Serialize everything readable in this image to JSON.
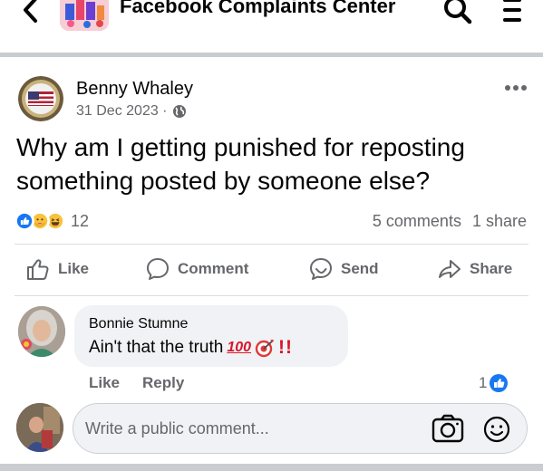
{
  "header": {
    "title": "Facebook Complaints Center",
    "back_icon": "chevron-left-icon",
    "search_icon": "search-icon",
    "menu_icon": "menu-icon"
  },
  "post": {
    "author": "Benny Whaley",
    "date": "31 Dec 2023 ·",
    "privacy_icon": "globe-icon",
    "text": "Why am I getting punished for reposting something posted by someone else?",
    "reaction_icons": [
      "like-reaction-icon",
      "care-reaction-icon",
      "haha-reaction-icon"
    ],
    "reaction_count": "12",
    "comments_count": "5 comments",
    "shares_count": "1 share"
  },
  "actions": {
    "like": "Like",
    "comment": "Comment",
    "send": "Send",
    "share": "Share"
  },
  "comment": {
    "author": "Bonnie Stumne",
    "text": "Ain't that the truth",
    "emoji_hundred": "100",
    "emoji_bang": "!!",
    "like_label": "Like",
    "reply_label": "Reply",
    "like_count": "1"
  },
  "composer": {
    "placeholder": "Write a public comment..."
  },
  "colors": {
    "facebook_blue": "#1877f2",
    "muted_text": "#65676b",
    "bubble_bg": "#f0f2f5",
    "divider": "#c9ccd1"
  }
}
